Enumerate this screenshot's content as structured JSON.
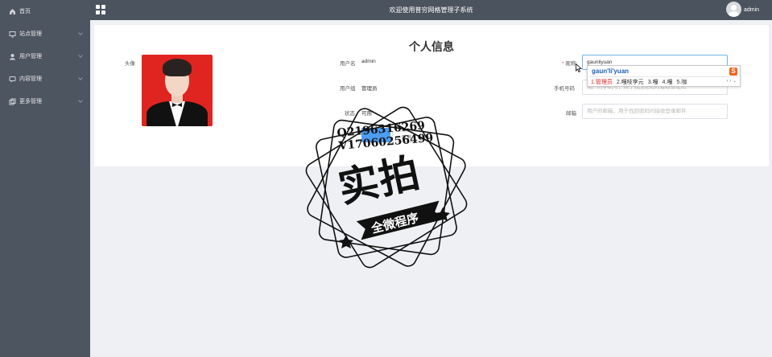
{
  "header": {
    "title": "欢迎使用普穷网格管理子系统",
    "user": "admin"
  },
  "sidebar": {
    "items": [
      {
        "label": "首页"
      },
      {
        "label": "站点管理"
      },
      {
        "label": "用户管理"
      },
      {
        "label": "内容管理"
      },
      {
        "label": "更多管理"
      }
    ]
  },
  "profile": {
    "title": "个人信息",
    "avatar_label": "头像",
    "username_label": "用户名",
    "username_value": "admin",
    "group_label": "用户组",
    "group_value": "管理员",
    "status_label": "状态",
    "status_value": "可用",
    "cancel_label": "取消",
    "nickname_label": "昵称:",
    "nickname_value": "gaunliyuan",
    "phone_label": "手机号码",
    "phone_placeholder": "用户的手机号，用于找回密码时接收验证码",
    "email_label": "邮箱",
    "email_placeholder": "用户的邮箱，用于找回密码时接收登录邮件"
  },
  "ime": {
    "pinyin": "gaun'li'yuan",
    "logo": "S",
    "candidates": [
      "1.管理员",
      "2.嘎吱李元",
      "3.嘎",
      "4.嘎",
      "5.咖"
    ]
  },
  "watermark": {
    "qq": "Q2196316269",
    "vx": "V17060256499",
    "main": "实拍",
    "banner": "全微程序"
  }
}
